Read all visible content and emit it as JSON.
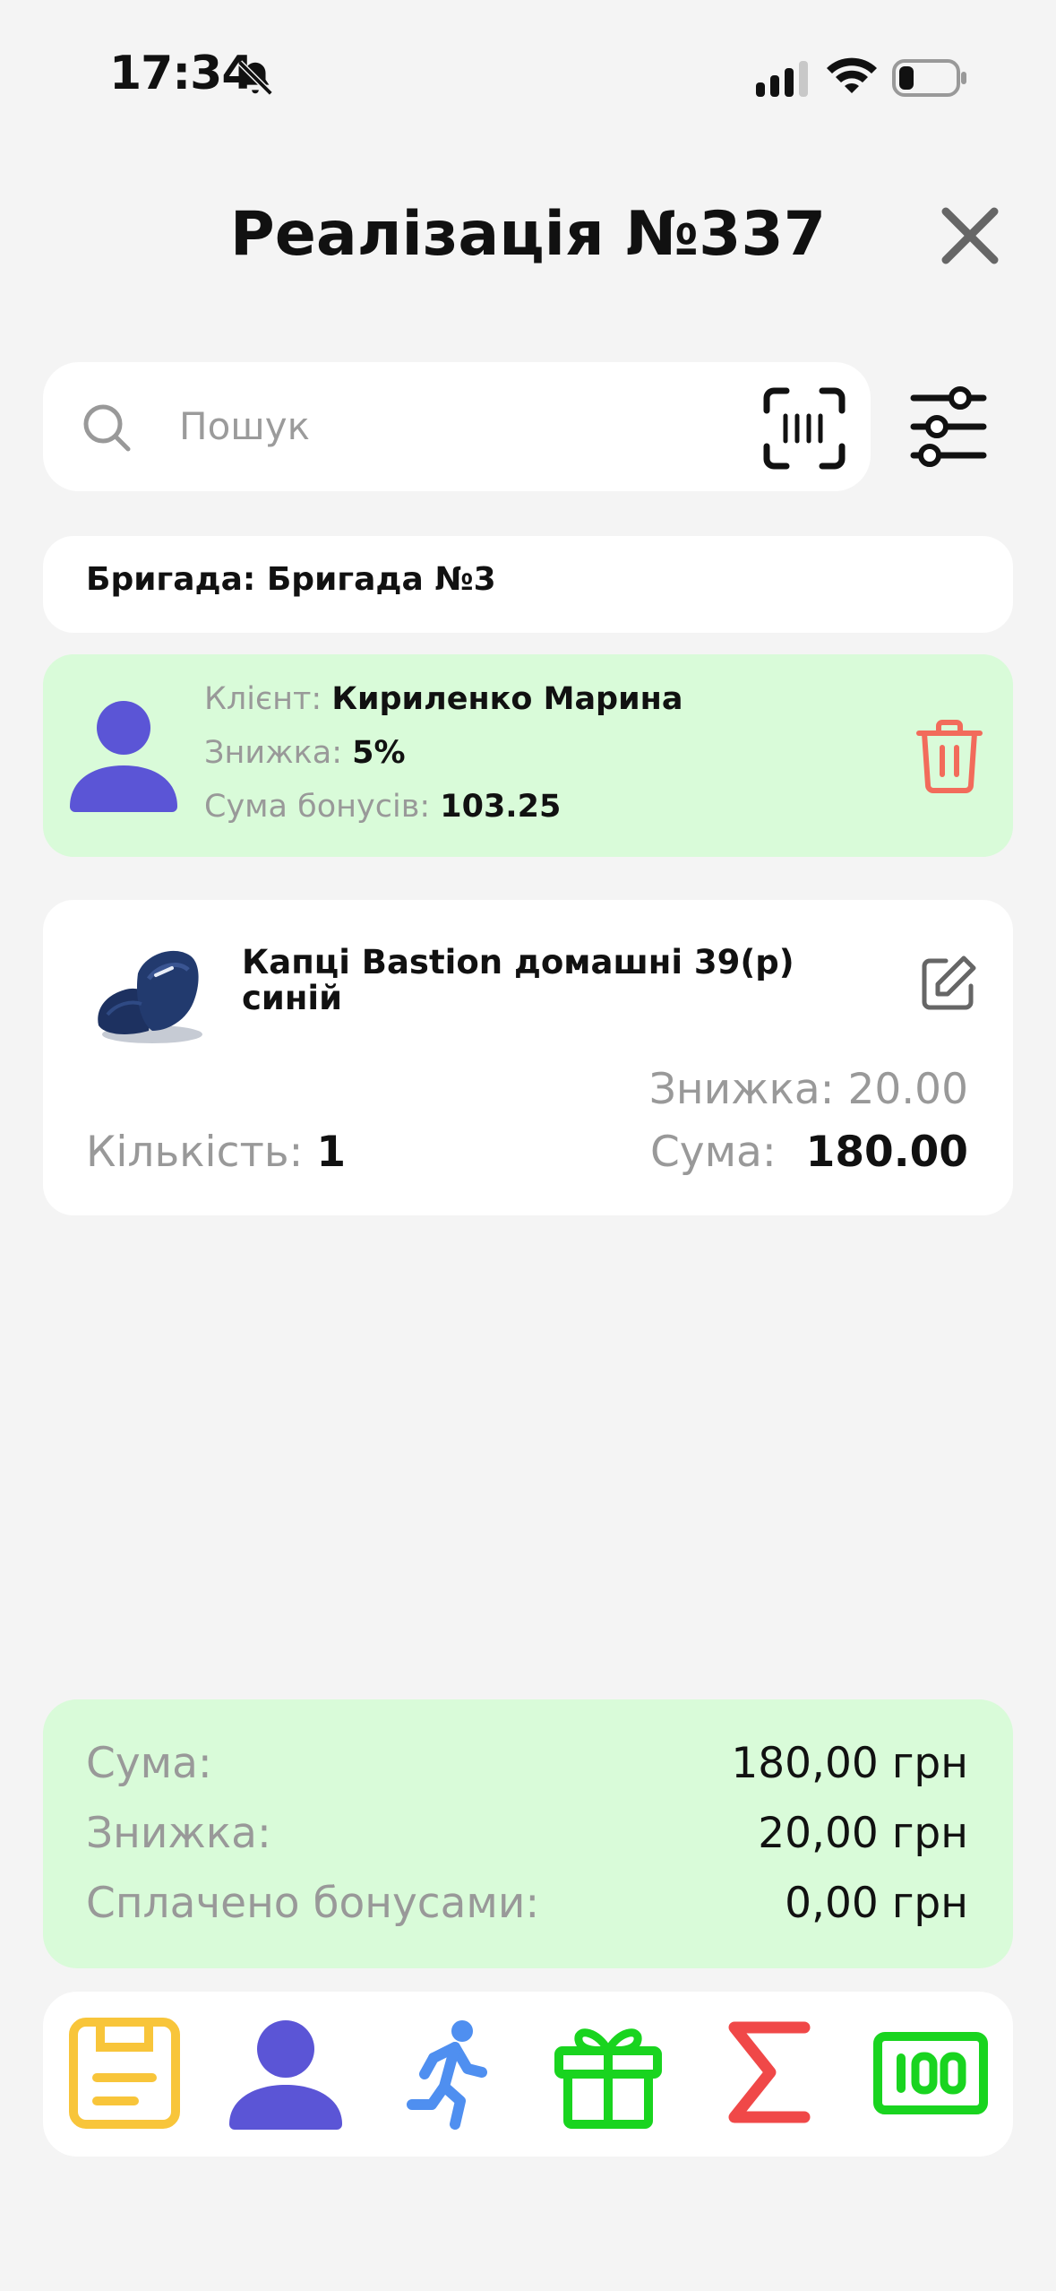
{
  "status_bar": {
    "time": "17:34"
  },
  "header": {
    "title": "Реалізація №337"
  },
  "search": {
    "placeholder": "Пошук"
  },
  "brigade": {
    "label": "Бригада:",
    "value": "Бригада №3"
  },
  "client": {
    "client_label": "Клієнт:",
    "client_name": "Кириленко Марина",
    "discount_label": "Знижка:",
    "discount_value": "5%",
    "bonus_label": "Сума бонусів:",
    "bonus_value": "103.25"
  },
  "product": {
    "name": "Капці Bastion домашні 39(р) синій",
    "discount_label": "Знижка:",
    "discount_value": "20.00",
    "qty_label": "Кількість:",
    "qty_value": "1",
    "sum_label": "Сума:",
    "sum_value": "180.00"
  },
  "totals": {
    "sum_label": "Сума:",
    "sum_value": "180,00 грн",
    "discount_label": "Знижка:",
    "discount_value": "20,00 грн",
    "bonus_label": "Сплачено бонусами:",
    "bonus_value": "0,00 грн"
  },
  "toolbar": {
    "icons": [
      "save-icon",
      "user-icon",
      "runner-icon",
      "gift-icon",
      "sigma-icon",
      "cash-icon"
    ]
  },
  "colors": {
    "accent_green_bg": "#d9fbd9",
    "avatar_purple": "#5b55d6",
    "trash_red": "#f26b5b",
    "save_yellow": "#f8c53a",
    "runner_blue": "#4f8ff0",
    "gift_green": "#19d41f",
    "sigma_red": "#f04848"
  }
}
